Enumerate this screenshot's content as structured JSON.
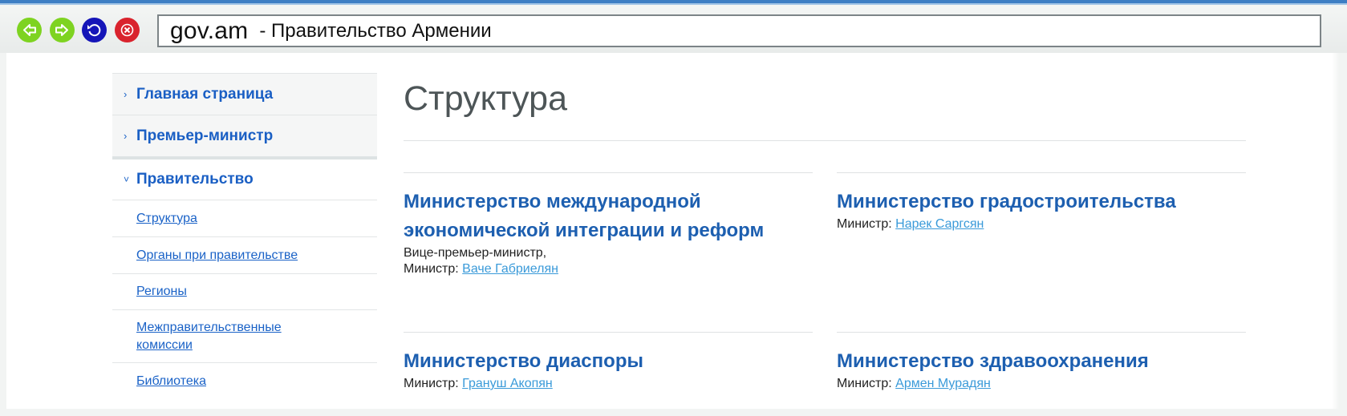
{
  "browser": {
    "domain": "gov.am",
    "title_suffix": "- Правительство Армении",
    "buttons": {
      "back_icon": "arrow-left-icon",
      "forward_icon": "arrow-right-icon",
      "reload_icon": "reload-icon",
      "stop_icon": "close-icon"
    },
    "colors": {
      "back": "#7ed321",
      "forward": "#7ed321",
      "reload": "#1515b8",
      "stop": "#d9232d"
    }
  },
  "sidebar": {
    "items": [
      {
        "label": "Главная страница",
        "chevron": "›"
      },
      {
        "label": "Премьер-министр",
        "chevron": "›"
      },
      {
        "label": "Правительство",
        "chevron": "˅"
      }
    ],
    "subitems": [
      "Структура",
      "Органы при правительстве",
      "Регионы",
      "Межправительственные комиссии",
      "Библиотека"
    ]
  },
  "main": {
    "title": "Структура",
    "ministries": [
      {
        "name": "Министерство международной экономической интеграции и реформ",
        "role_prefix": "Вице-премьер-министр,",
        "role_label": "Министр:",
        "person": "Ваче Габриелян"
      },
      {
        "name": "Министерство градостроительства",
        "role_label": "Министр:",
        "person": "Нарек Саргсян"
      },
      {
        "name": "Министерство диаспоры",
        "role_label": "Министр:",
        "person": "Грануш Акопян"
      },
      {
        "name": "Министерство здравоохранения",
        "role_label": "Министр:",
        "person": "Армен Мурадян"
      }
    ]
  },
  "colors": {
    "accent": "#1a5fc4",
    "heading": "#1d5fb0",
    "link": "#3a9ad9"
  }
}
